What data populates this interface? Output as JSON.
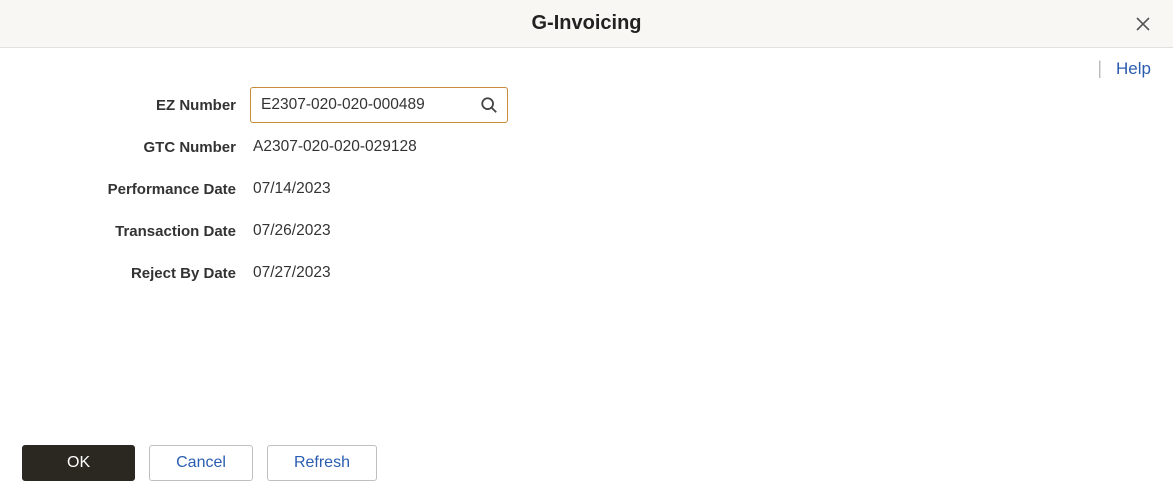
{
  "header": {
    "title": "G-Invoicing"
  },
  "toolbar": {
    "help_label": "Help"
  },
  "form": {
    "ez_number": {
      "label": "EZ Number",
      "value": "E2307-020-020-000489"
    },
    "gtc_number": {
      "label": "GTC Number",
      "value": "A2307-020-020-029128"
    },
    "performance_date": {
      "label": "Performance Date",
      "value": "07/14/2023"
    },
    "transaction_date": {
      "label": "Transaction Date",
      "value": "07/26/2023"
    },
    "reject_by_date": {
      "label": "Reject By Date",
      "value": "07/27/2023"
    }
  },
  "buttons": {
    "ok": "OK",
    "cancel": "Cancel",
    "refresh": "Refresh"
  }
}
